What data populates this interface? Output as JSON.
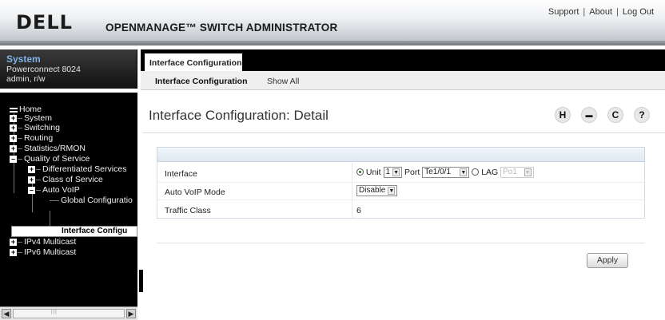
{
  "header": {
    "logo": "DELL",
    "app_title": "OPENMANAGE™ SWITCH ADMINISTRATOR",
    "links": [
      "Support",
      "About",
      "Log Out"
    ]
  },
  "system": {
    "title": "System",
    "model": "Powerconnect 8024",
    "user": "admin, r/w"
  },
  "nav": {
    "home": "Home",
    "system": "System",
    "switching": "Switching",
    "routing": "Routing",
    "stats": "Statistics/RMON",
    "qos": "Quality of Service",
    "diffserv": "Differentiated Services",
    "cos": "Class of Service",
    "autovoip": "Auto VoIP",
    "global": "Global Configuratio",
    "intf": "Interface Configu",
    "ipv4mc": "IPv4 Multicast",
    "ipv6mc": "IPv6 Multicast"
  },
  "tabs": {
    "main": "Interface Configuration",
    "sub_active": "Interface Configuration",
    "sub_other": "Show All"
  },
  "page": {
    "title": "Interface Configuration: Detail",
    "tools": [
      "H",
      "▬",
      "C",
      "?"
    ]
  },
  "form": {
    "interface_label": "Interface",
    "unit_label": "Unit",
    "unit_value": "1",
    "port_label": "Port",
    "port_value": "Te1/0/1",
    "lag_label": "LAG",
    "lag_value": "Po1",
    "voip_label": "Auto VoIP Mode",
    "voip_value": "Disable",
    "tc_label": "Traffic Class",
    "tc_value": "6",
    "apply": "Apply"
  }
}
